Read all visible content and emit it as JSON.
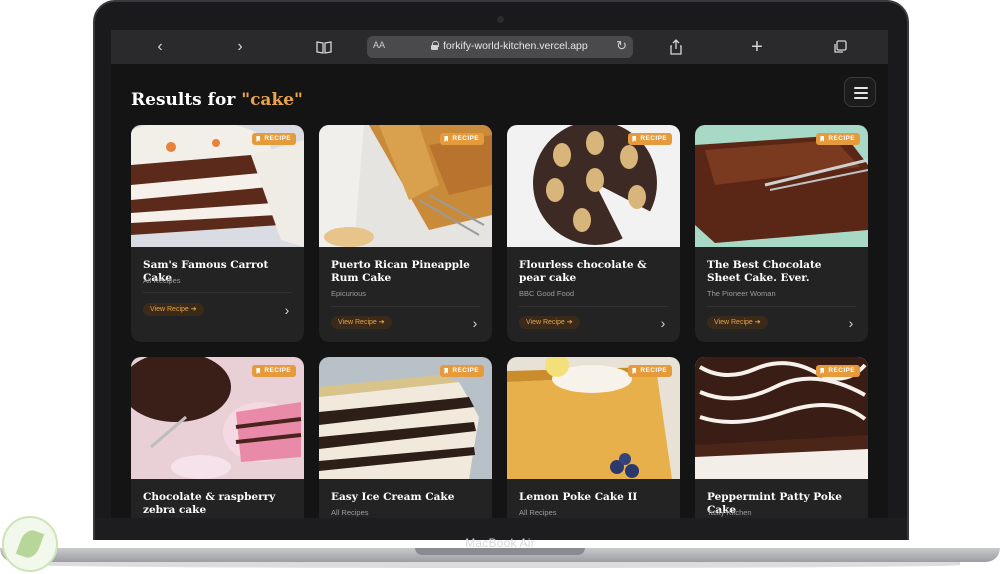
{
  "browser": {
    "address_prefix": "AA",
    "url": "forkify-world-kitchen.vercel.app",
    "icons": [
      "back-icon",
      "forward-icon",
      "book-icon",
      "reload-icon",
      "share-icon",
      "plus-icon",
      "tabs-icon"
    ]
  },
  "header": {
    "results_prefix": "Results for",
    "query": "\"cake\""
  },
  "card_ui": {
    "badge_label": "RECIPE",
    "view_label": "View Recipe ➔"
  },
  "recipes": [
    {
      "name": "Sam's Famous Carrot Cake",
      "source": "All Recipes"
    },
    {
      "name": "Puerto Rican Pineapple Rum Cake",
      "source": "Epicurious"
    },
    {
      "name": "Flourless chocolate & pear cake",
      "source": "BBC Good Food"
    },
    {
      "name": "The Best Chocolate Sheet Cake. Ever.",
      "source": "The Pioneer Woman"
    },
    {
      "name": "Chocolate & raspberry zebra cake",
      "source": ""
    },
    {
      "name": "Easy Ice Cream Cake",
      "source": "All Recipes"
    },
    {
      "name": "Lemon Poke Cake II",
      "source": "All Recipes"
    },
    {
      "name": "Peppermint Patty Poke Cake",
      "source": "Tasty Kitchen"
    }
  ],
  "device": {
    "model_label": "MacBook Air"
  },
  "colors": {
    "accent": "#e8a44b",
    "badge": "#e59a3c",
    "page_bg": "#141414",
    "card_bg": "#232323"
  }
}
